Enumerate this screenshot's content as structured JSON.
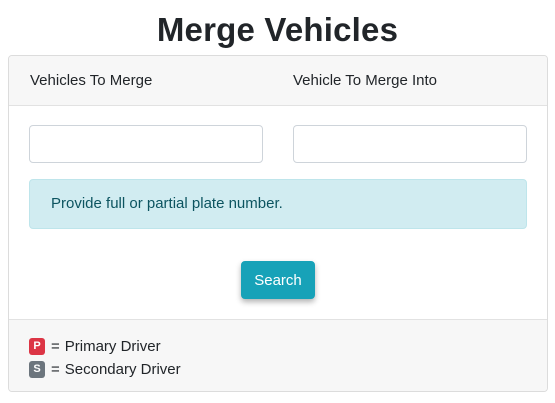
{
  "page": {
    "title": "Merge Vehicles"
  },
  "header": {
    "left_label": "Vehicles To Merge",
    "right_label": "Vehicle To Merge Into"
  },
  "form": {
    "left_input_value": "",
    "right_input_value": "",
    "info_message": "Provide full or partial plate number.",
    "search_label": "Search"
  },
  "legend": {
    "primary_badge": "P",
    "primary_text": "Primary Driver",
    "secondary_badge": "S",
    "secondary_text": "Secondary Driver",
    "separator": "="
  },
  "colors": {
    "search_button": "#17a2b8",
    "info_alert_bg": "#d1ecf1",
    "info_alert_text": "#0c5460",
    "primary_badge": "#dc3545",
    "secondary_badge": "#6c757d"
  }
}
